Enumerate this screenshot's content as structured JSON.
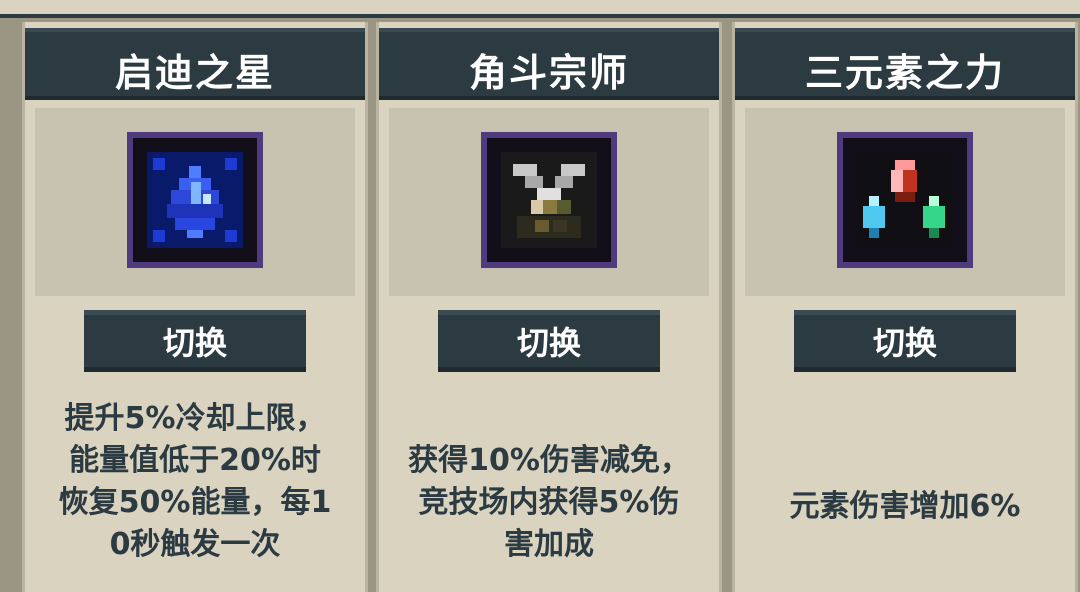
{
  "top_strip": {
    "label": ""
  },
  "panels": [
    {
      "title": "启迪之星",
      "icon": "blue-star-gem-icon",
      "button_label": "切换",
      "description_lines": [
        "提升5%冷却上限，",
        "能量值低于20%时",
        "恢复50%能量，每1",
        "0秒触发一次"
      ]
    },
    {
      "title": "角斗宗师",
      "icon": "crossed-swords-gladiator-icon",
      "button_label": "切换",
      "description_lines": [
        "获得10%伤害减免，",
        "竞技场内获得5%伤",
        "害加成"
      ]
    },
    {
      "title": "三元素之力",
      "icon": "three-element-crystals-icon",
      "button_label": "切换",
      "description_lines": [
        "元素伤害增加6%"
      ]
    }
  ],
  "colors": {
    "panel_bg": "#d9d3c0",
    "header_bg": "#2c3a42",
    "icon_frame": "#4e3a7d",
    "text_dark": "#2c3a42"
  }
}
